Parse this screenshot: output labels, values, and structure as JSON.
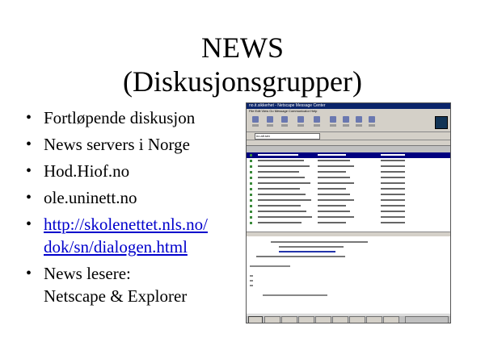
{
  "slide": {
    "title_line1": "NEWS",
    "title_line2": "(Diskusjonsgrupper)",
    "bullets": [
      "Fortløpende diskusjon",
      "News servers i Norge",
      "Hod.Hiof.no",
      "ole.uninett.no"
    ],
    "link_line1": "http://skolenettet.nls.no/",
    "link_line2": "dok/sn/dialogen.html",
    "readers_line1": "News lesere:",
    "readers_line2": "Netscape & Explorer"
  },
  "screenshot": {
    "window_title": "no.it.sikkerhet - Netscape Message Center",
    "menu": "File  Edit  View  Go  Message  Communicator  Help",
    "folder_value": "no.alt.sex",
    "list_rows": 13
  }
}
